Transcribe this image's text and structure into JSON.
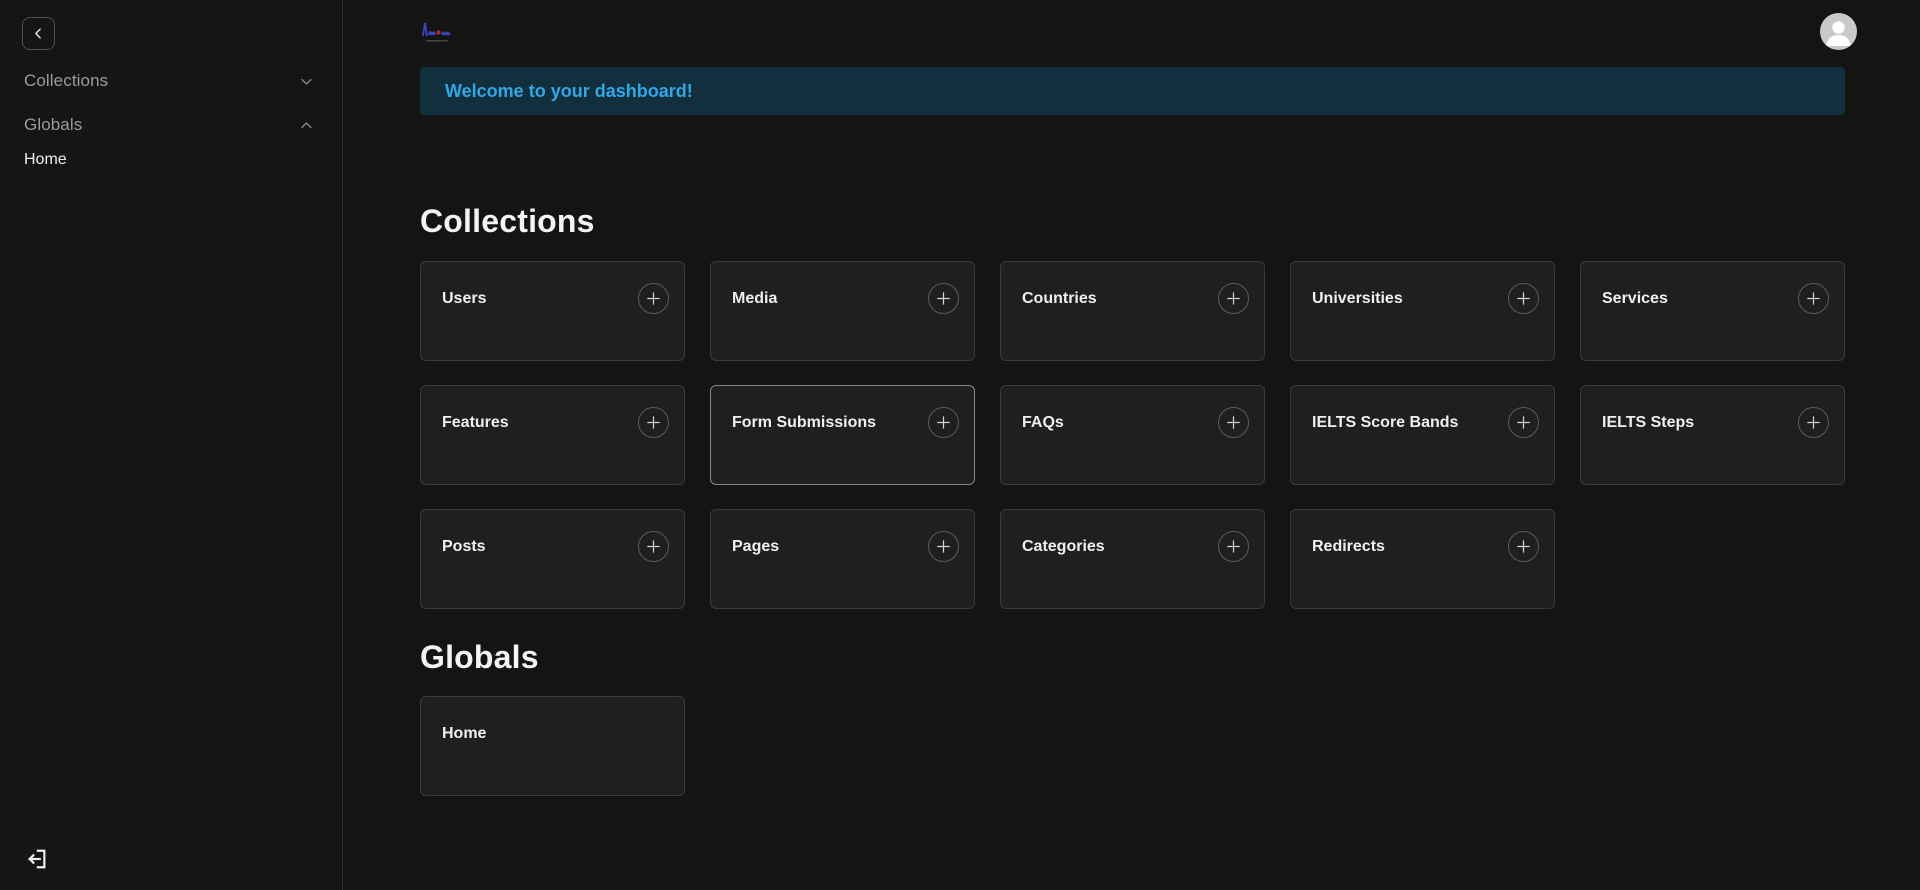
{
  "sidebar": {
    "back_button": {
      "icon": "chevron-left"
    },
    "groups": [
      {
        "label": "Collections",
        "state": "collapsed",
        "chevron_icon": "chevron-down"
      },
      {
        "label": "Globals",
        "state": "expanded",
        "chevron_icon": "chevron-up",
        "items": [
          {
            "label": "Home"
          }
        ]
      }
    ],
    "logout": {
      "icon": "log-out"
    }
  },
  "header": {
    "logo_icon": "site-logo",
    "avatar_icon": "user-silhouette"
  },
  "banner": {
    "message": "Welcome to your dashboard!"
  },
  "sections": [
    {
      "title": "Collections",
      "cards": [
        {
          "label": "Users",
          "has_add": true
        },
        {
          "label": "Media",
          "has_add": true
        },
        {
          "label": "Countries",
          "has_add": true
        },
        {
          "label": "Universities",
          "has_add": true
        },
        {
          "label": "Services",
          "has_add": true
        },
        {
          "label": "Features",
          "has_add": true
        },
        {
          "label": "Form Submissions",
          "has_add": true,
          "highlighted": true
        },
        {
          "label": "FAQs",
          "has_add": true
        },
        {
          "label": "IELTS Score Bands",
          "has_add": true
        },
        {
          "label": "IELTS Steps",
          "has_add": true
        },
        {
          "label": "Posts",
          "has_add": true
        },
        {
          "label": "Pages",
          "has_add": true
        },
        {
          "label": "Categories",
          "has_add": true
        },
        {
          "label": "Redirects",
          "has_add": true
        }
      ]
    },
    {
      "title": "Globals",
      "cards": [
        {
          "label": "Home",
          "has_add": false
        }
      ]
    }
  ],
  "colors": {
    "page_bg": "#141414",
    "sidebar_bg": "#151515",
    "card_bg": "#1f1f1f",
    "card_border": "#3a3a3a",
    "card_border_highlight": "#868686",
    "banner_bg": "#122f3e",
    "banner_text": "#2fa8e9",
    "text_primary": "#f0f0f0",
    "text_muted": "#9b9b9b",
    "avatar_bg": "#c9c9c9"
  }
}
